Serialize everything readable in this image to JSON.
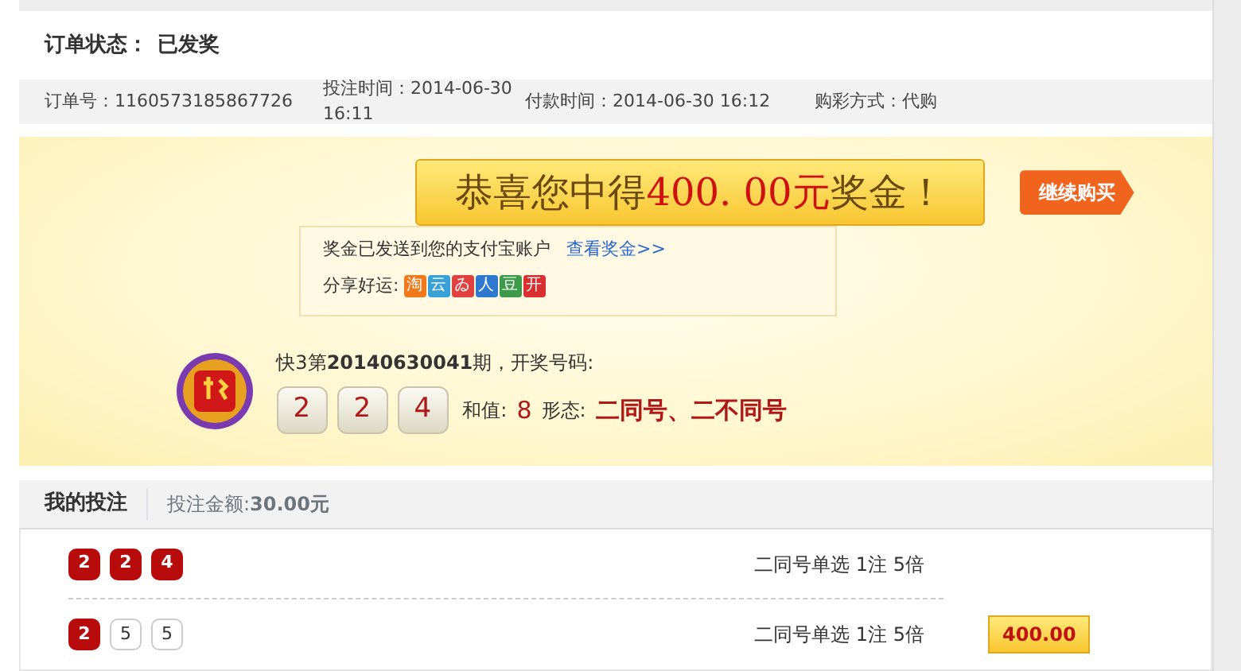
{
  "order_status": {
    "label": "订单状态：",
    "value": "已发奖"
  },
  "order_info": [
    {
      "label": "订单号：",
      "value": "1160573185867726"
    },
    {
      "label": "投注时间：",
      "value": "2014-06-30 16:11"
    },
    {
      "label": "付款时间：",
      "value": "2014-06-30 16:12"
    },
    {
      "label": "购彩方式：",
      "value": "代购"
    }
  ],
  "prize": {
    "banner": "恭喜您中得**400. 00元**奖金！",
    "continue_button": "继续购买",
    "notice": "奖金已发送到您的支付宝账户",
    "notice_link": "查看奖金>>",
    "share_label": "分享好运:",
    "share_icons": [
      {
        "text": "淘",
        "color": "#f07a1a"
      },
      {
        "text": "云",
        "color": "#3aa0d8"
      },
      {
        "text": "ゐ",
        "color": "#e04040"
      },
      {
        "text": "人",
        "color": "#2f78d0"
      },
      {
        "text": "豆",
        "color": "#3e9a4a"
      },
      {
        "text": "开",
        "color": "#d83030"
      }
    ]
  },
  "draw": {
    "caption": "快3第**20140630041**期，开奖号码:",
    "numbers": [
      "2",
      "2",
      "4"
    ],
    "sum_label": "和值:",
    "sum": "8",
    "pattern_label": "形态:",
    "pattern": "二同号、二不同号"
  },
  "bets": {
    "title": "我的投注",
    "amount_label": "投注金额:",
    "amount": "30.00元",
    "rows": [
      {
        "balls": [
          {
            "n": "2",
            "matched": true
          },
          {
            "n": "2",
            "matched": true
          },
          {
            "n": "4",
            "matched": true
          }
        ],
        "play": "二同号单选 1注 5倍"
      },
      {
        "balls": [
          {
            "n": "2",
            "matched": true
          },
          {
            "n": "5",
            "matched": false
          },
          {
            "n": "5",
            "matched": false
          }
        ],
        "play": "二同号单选 1注 5倍"
      }
    ],
    "win_amount": "400.00"
  }
}
